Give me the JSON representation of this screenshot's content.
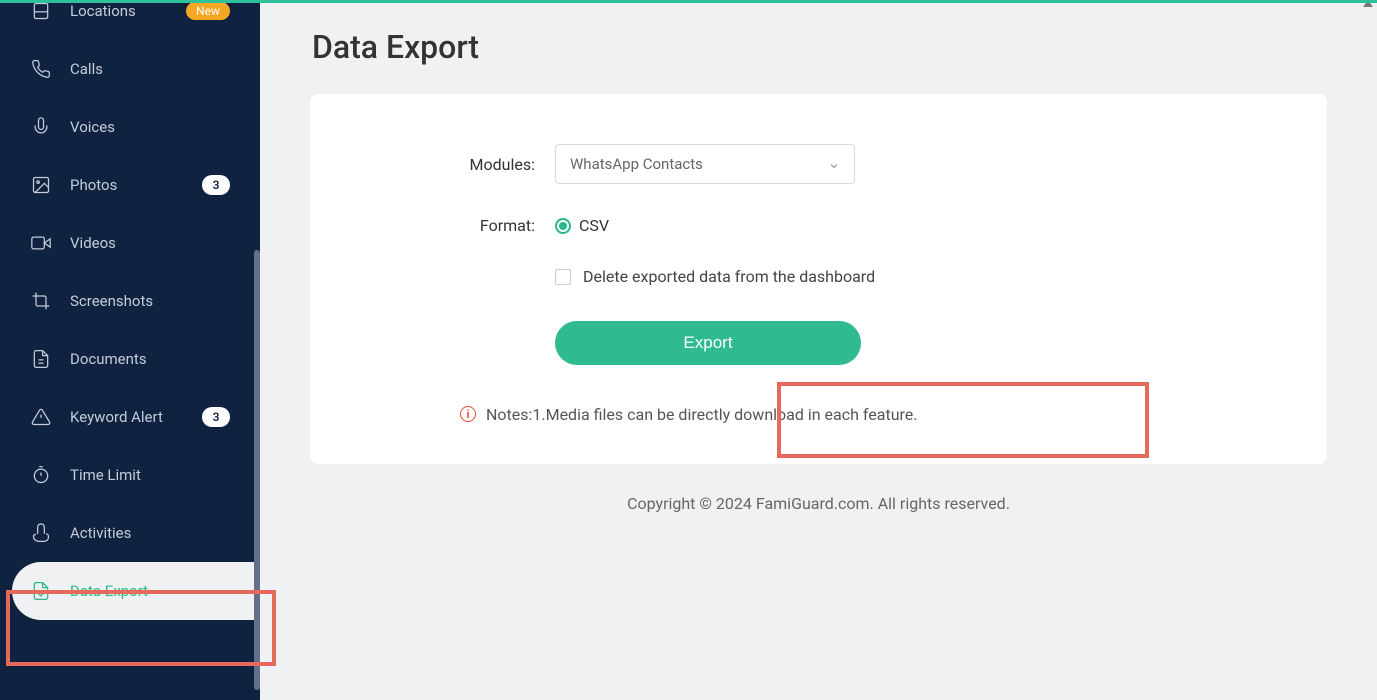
{
  "sidebar": {
    "items": [
      {
        "label": "Locations",
        "badge_new": "New"
      },
      {
        "label": "Calls"
      },
      {
        "label": "Voices"
      },
      {
        "label": "Photos",
        "count": "3"
      },
      {
        "label": "Videos"
      },
      {
        "label": "Screenshots"
      },
      {
        "label": "Documents"
      },
      {
        "label": "Keyword Alert",
        "count": "3"
      },
      {
        "label": "Time Limit"
      },
      {
        "label": "Activities"
      },
      {
        "label": "Data Export"
      }
    ]
  },
  "page": {
    "title": "Data Export"
  },
  "form": {
    "modules_label": "Modules:",
    "modules_value": "WhatsApp Contacts",
    "format_label": "Format:",
    "format_value": "CSV",
    "delete_label": "Delete exported data from the dashboard",
    "export_btn": "Export",
    "notes": "Notes:1.Media files can be directly download in each feature."
  },
  "footer": {
    "copyright": "Copyright © 2024 FamiGuard.com. All rights reserved."
  }
}
